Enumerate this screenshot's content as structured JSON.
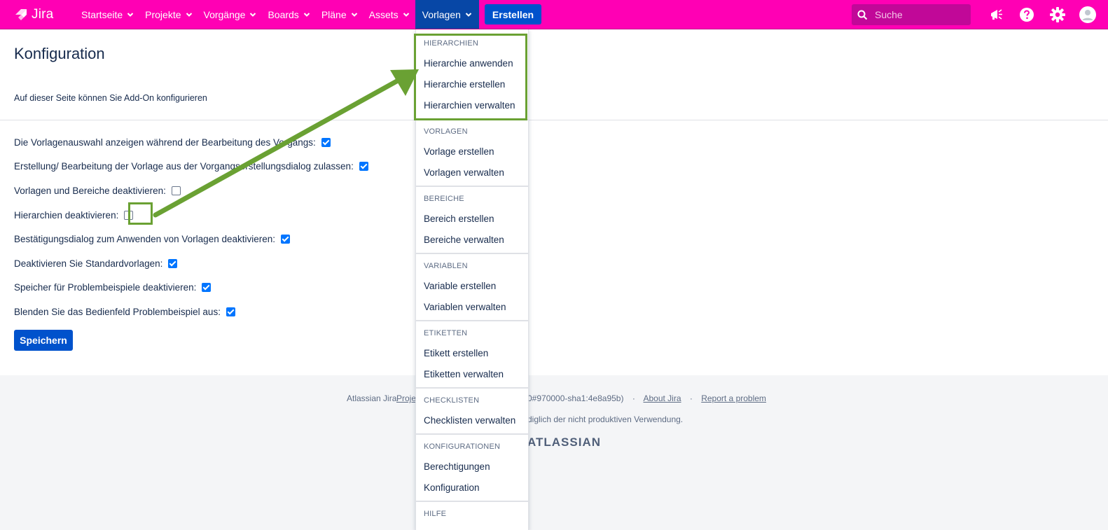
{
  "app": {
    "name": "Jira"
  },
  "topnav": {
    "items": [
      {
        "label": "Startseite"
      },
      {
        "label": "Projekte"
      },
      {
        "label": "Vorgänge"
      },
      {
        "label": "Boards"
      },
      {
        "label": "Pläne"
      },
      {
        "label": "Assets"
      },
      {
        "label": "Vorlagen"
      }
    ],
    "create_label": "Erstellen",
    "search_placeholder": "Suche",
    "brand_color": "#ff00b4",
    "active_color": "#0747a6"
  },
  "page": {
    "title": "Konfiguration",
    "description": "Auf dieser Seite können Sie Add-On konfigurieren",
    "options": [
      {
        "label": "Die Vorlagenauswahl anzeigen während der Bearbeitung des Vorgangs:",
        "checked": true
      },
      {
        "label": "Erstellung/ Bearbeitung der Vorlage aus der Vorgangserstellungsdialog zulassen:",
        "checked": true
      },
      {
        "label": "Vorlagen und Bereiche deaktivieren:",
        "checked": false
      },
      {
        "label": "Hierarchien deaktivieren:",
        "checked": false
      },
      {
        "label": "Bestätigungsdialog zum Anwenden von Vorlagen deaktivieren:",
        "checked": true
      },
      {
        "label": "Deaktivieren Sie Standardvorlagen:",
        "checked": true
      },
      {
        "label": "Speicher für Problembeispiele deaktivieren:",
        "checked": true
      },
      {
        "label": "Blenden Sie das Bedienfeld Problembeispiel aus:",
        "checked": true
      }
    ],
    "save_label": "Speichern"
  },
  "footer": {
    "prefix": "Atlassian Jira",
    "link_fragment": "Proje",
    "version_fragment": "0#970000-sha1:4e8a95b)",
    "about_link": "About Jira",
    "report_link": "Report a problem",
    "license_fragment": "diglich der nicht produktiven Verwendung.",
    "logo_fragment": "ATLASSIAN"
  },
  "dropdown": {
    "sections": [
      {
        "heading": "HIERARCHIEN",
        "items": [
          "Hierarchie anwenden",
          "Hierarchie erstellen",
          "Hierarchien verwalten"
        ]
      },
      {
        "heading": "VORLAGEN",
        "items": [
          "Vorlage erstellen",
          "Vorlagen verwalten"
        ]
      },
      {
        "heading": "BEREICHE",
        "items": [
          "Bereich erstellen",
          "Bereiche verwalten"
        ]
      },
      {
        "heading": "VARIABLEN",
        "items": [
          "Variable erstellen",
          "Variablen verwalten"
        ]
      },
      {
        "heading": "ETIKETTEN",
        "items": [
          "Etikett erstellen",
          "Etiketten verwalten"
        ]
      },
      {
        "heading": "CHECKLISTEN",
        "items": [
          "Checklisten verwalten"
        ]
      },
      {
        "heading": "KONFIGURATIONEN",
        "items": [
          "Berechtigungen",
          "Konfiguration"
        ]
      },
      {
        "heading": "HILFE",
        "items": []
      }
    ]
  },
  "annotation": {
    "highlight_color": "#6aa133"
  }
}
